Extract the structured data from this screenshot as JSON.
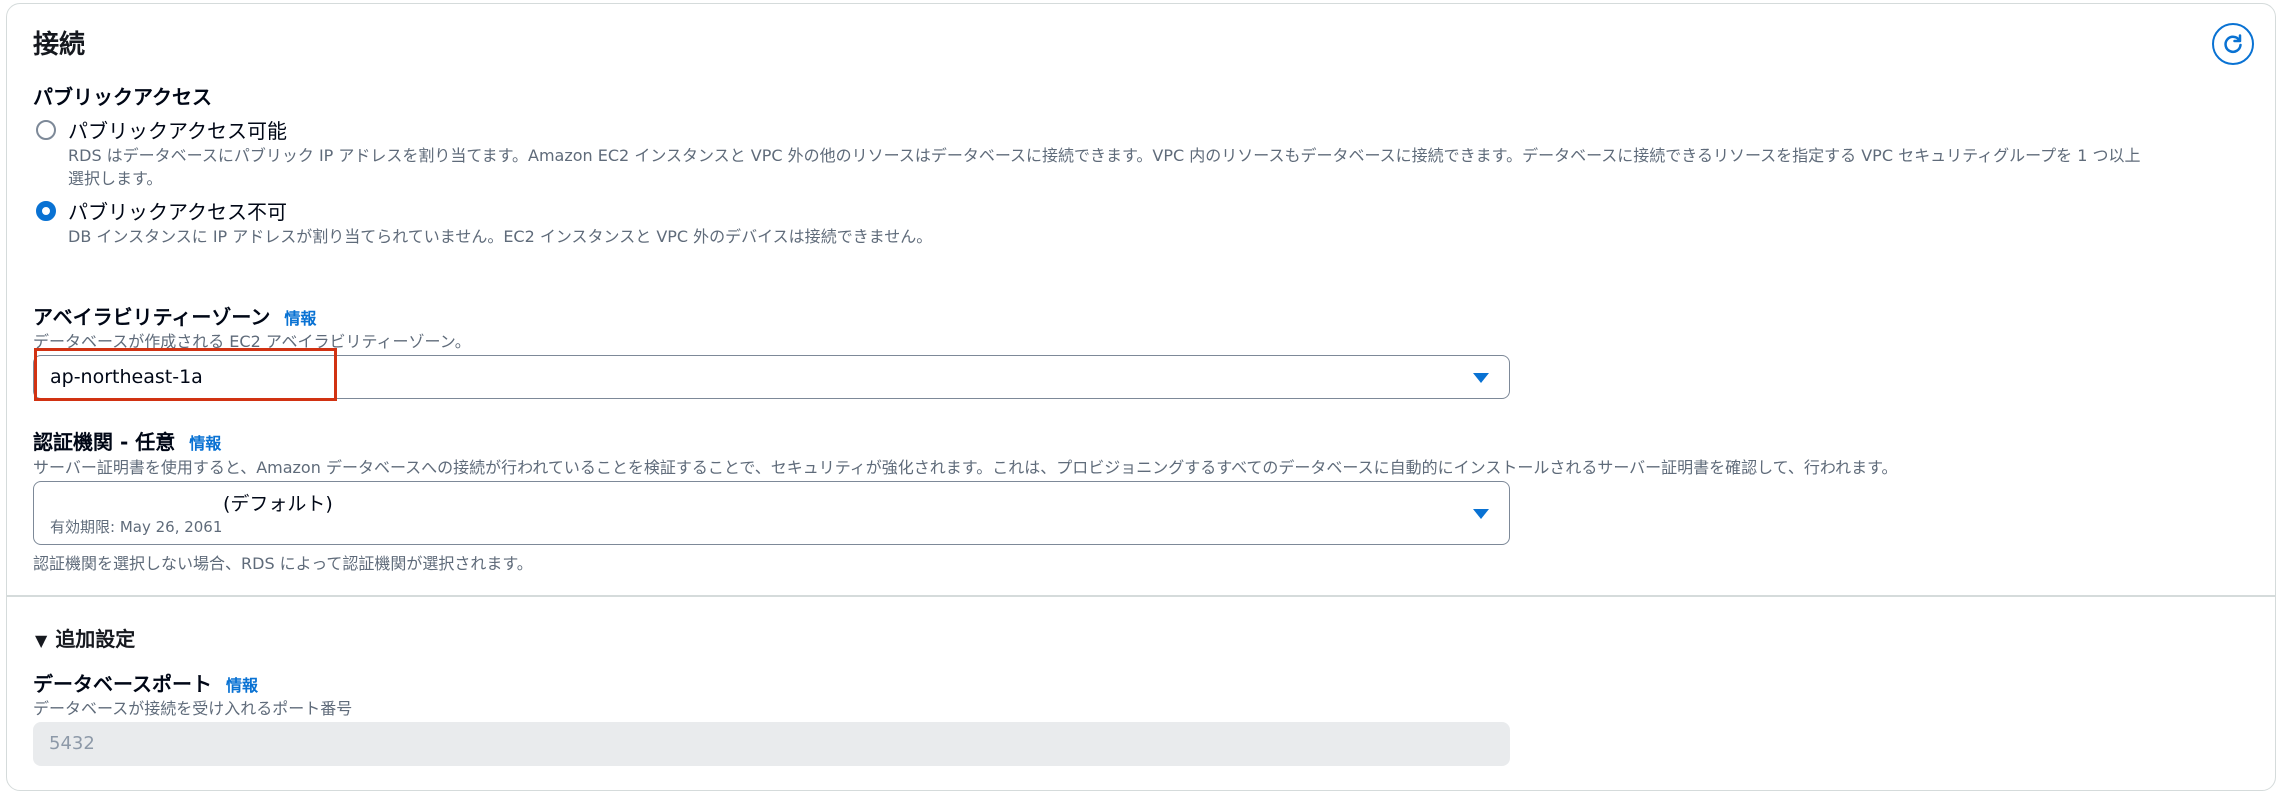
{
  "section": {
    "title": "接続"
  },
  "public_access": {
    "label": "パブリックアクセス",
    "options": [
      {
        "label": "パブリックアクセス可能",
        "description_line1": "RDS はデータベースにパブリック IP アドレスを割り当てます。Amazon EC2 インスタンスと VPC 外の他のリソースはデータベースに接続できます。VPC 内のリソースもデータベースに接続できます。データベースに接続できるリソースを指定する VPC セキュリティグループを 1 つ以上",
        "description_line2": "選択します。",
        "selected": false
      },
      {
        "label": "パブリックアクセス不可",
        "description_line1": "DB インスタンスに IP アドレスが割り当てられていません。EC2 インスタンスと VPC 外のデバイスは接続できません。",
        "selected": true
      }
    ]
  },
  "availability_zone": {
    "label": "アベイラビリティーゾーン",
    "info": "情報",
    "description": "データベースが作成される EC2 アベイラビリティーゾーン。",
    "value": "ap-northeast-1a"
  },
  "certificate_authority": {
    "label": "認証機関 - 任意",
    "info": "情報",
    "description": "サーバー証明書を使用すると、Amazon データベースへの接続が行われていることを検証することで、セキュリティが強化されます。これは、プロビジョニングするすべてのデータベースに自動的にインストールされるサーバー証明書を確認して、行われます。",
    "value": "(デフォルト)",
    "expiry": "有効期限: May 26, 2061",
    "footnote": "認証機関を選択しない場合、RDS によって認証機関が選択されます。"
  },
  "additional_settings": {
    "label": "追加設定",
    "port": {
      "label": "データベースポート",
      "info": "情報",
      "description": "データベースが接続を受け入れるポート番号",
      "value": "5432"
    }
  },
  "colors": {
    "accent": "#0972d3",
    "highlight": "#d13212"
  }
}
